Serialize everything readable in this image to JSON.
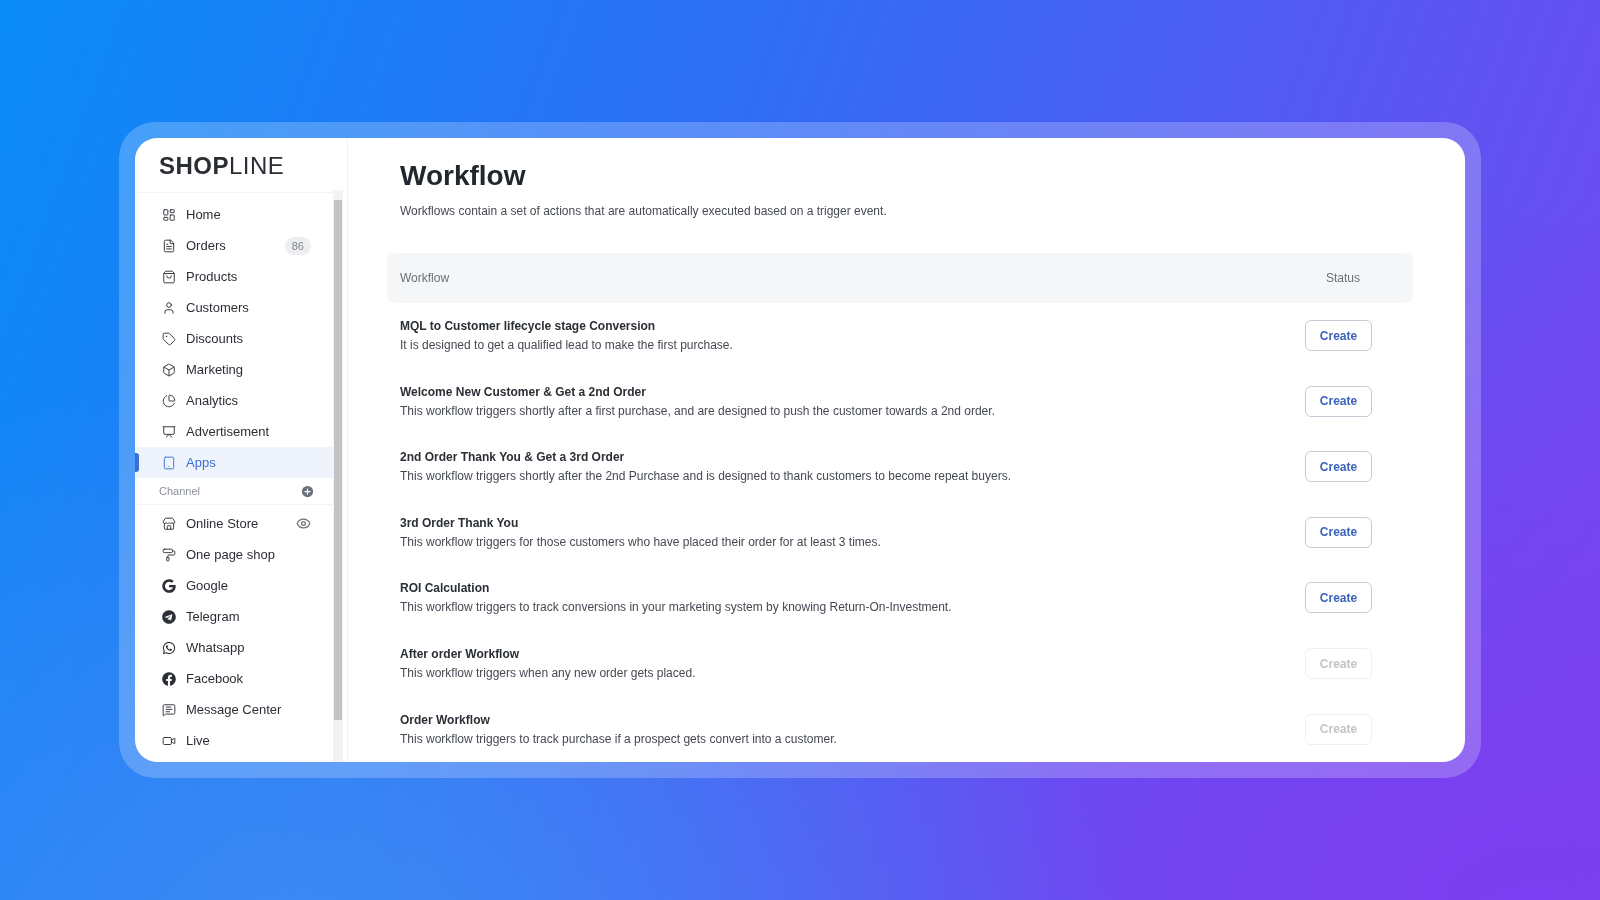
{
  "logo": "**SHOP**LINE",
  "sidebar": {
    "items": [
      {
        "label": "Home",
        "selected": false
      },
      {
        "label": "Orders",
        "selected": false,
        "badge": "86"
      },
      {
        "label": "Products",
        "selected": false
      },
      {
        "label": "Customers",
        "selected": false
      },
      {
        "label": "Discounts",
        "selected": false
      },
      {
        "label": "Marketing",
        "selected": false
      },
      {
        "label": "Analytics",
        "selected": false
      },
      {
        "label": "Advertisement",
        "selected": false
      },
      {
        "label": "Apps",
        "selected": true
      }
    ],
    "channel_header": "Channel",
    "channels": [
      {
        "label": "Online Store",
        "selected": false
      },
      {
        "label": "One page shop",
        "selected": false
      },
      {
        "label": "Google",
        "selected": false
      },
      {
        "label": "Telegram",
        "selected": false
      },
      {
        "label": "Whatsapp",
        "selected": false
      },
      {
        "label": "Facebook",
        "selected": false
      },
      {
        "label": "Message Center",
        "selected": false
      },
      {
        "label": "Live",
        "selected": false
      }
    ]
  },
  "page": {
    "title": "Workflow",
    "subtitle": "Workflows contain a set of actions that are automatically executed based on a trigger event."
  },
  "table": {
    "columns": [
      "Workflow",
      "Status"
    ],
    "rows": [
      {
        "title": "MQL to Customer lifecycle stage Conversion",
        "description": "It is designed to get a qualified lead to make the first purchase.",
        "button": "Create",
        "disabled": false
      },
      {
        "title": "Welcome New Customer & Get a 2nd Order",
        "description": "This workflow triggers shortly after a first purchase, and are designed to push the customer towards a 2nd order.",
        "button": "Create",
        "disabled": false
      },
      {
        "title": "2nd Order Thank You & Get a 3rd Order",
        "description": "This workflow triggers shortly after the 2nd Purchase and is designed to thank customers to become repeat buyers.",
        "button": "Create",
        "disabled": false
      },
      {
        "title": "3rd Order Thank You",
        "description": "This workflow triggers for those customers who have placed their order for at least 3 times.",
        "button": "Create",
        "disabled": false
      },
      {
        "title": "ROI Calculation",
        "description": "This workflow triggers to track conversions in your marketing system by knowing Return-On-Investment.",
        "button": "Create",
        "disabled": false
      },
      {
        "title": "After order Workflow",
        "description": "This workflow triggers when any new order gets placed.",
        "button": "Create",
        "disabled": true
      },
      {
        "title": "Order Workflow",
        "description": "This workflow triggers to track purchase if a prospect gets convert into a customer.",
        "button": "Create",
        "disabled": true
      }
    ]
  }
}
